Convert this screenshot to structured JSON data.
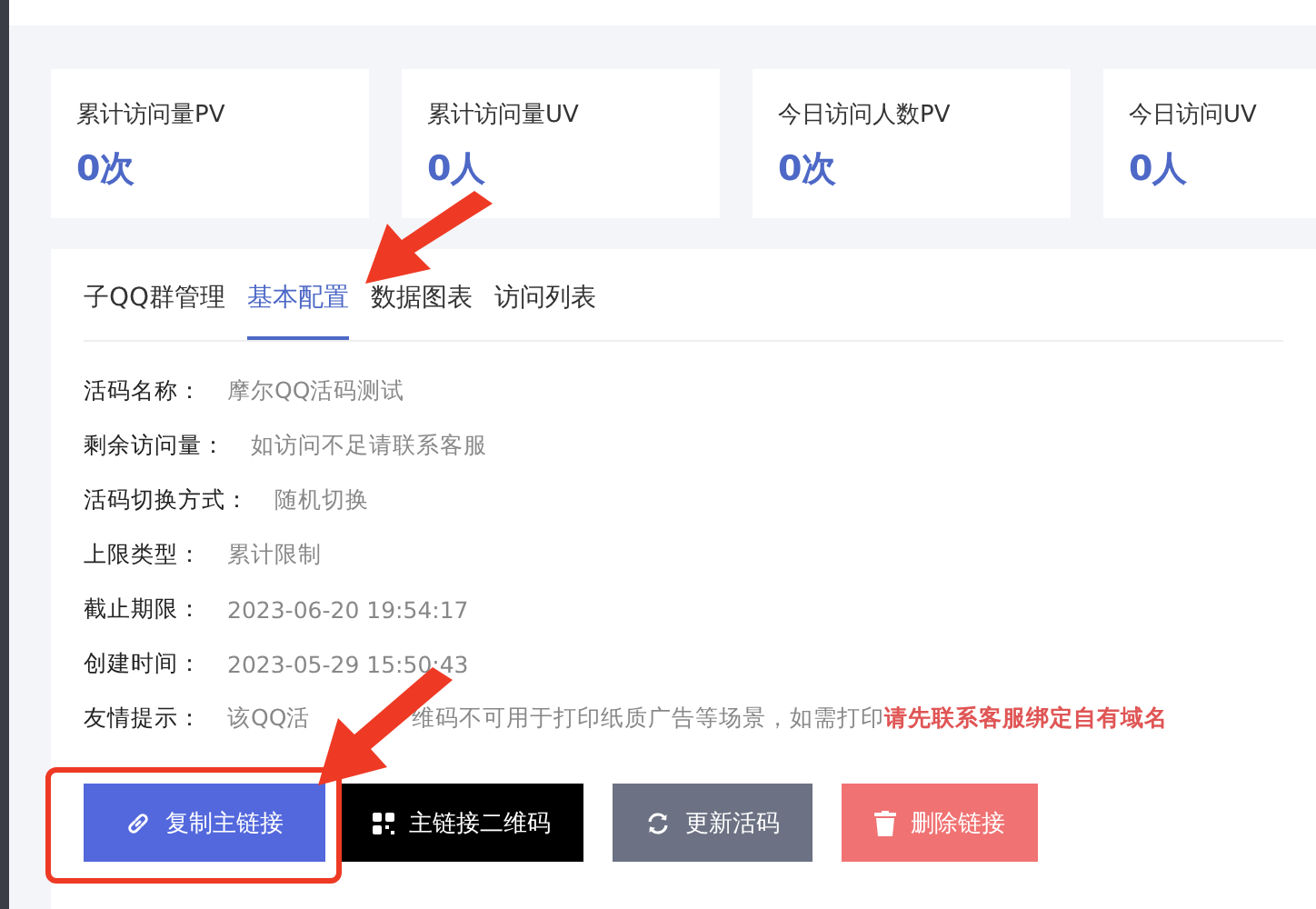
{
  "stats": [
    {
      "label": "累计访问量PV",
      "value": "0次"
    },
    {
      "label": "累计访问量UV",
      "value": "0人"
    },
    {
      "label": "今日访问人数PV",
      "value": "0次"
    },
    {
      "label": "今日访问UV",
      "value": "0人"
    }
  ],
  "tabs": [
    {
      "label": "子QQ群管理",
      "selected": false
    },
    {
      "label": "基本配置",
      "selected": true
    },
    {
      "label": "数据图表",
      "selected": false
    },
    {
      "label": "访问列表",
      "selected": false
    }
  ],
  "fields": [
    {
      "label": "活码名称：",
      "value": "摩尔QQ活码测试"
    },
    {
      "label": "剩余访问量：",
      "value": "如访问不足请联系客服"
    },
    {
      "label": "活码切换方式：",
      "value": "随机切换"
    },
    {
      "label": "上限类型：",
      "value": "累计限制"
    },
    {
      "label": "截止期限：",
      "value": "2023-06-20 19:54:17"
    },
    {
      "label": "创建时间：",
      "value": "2023-05-29 15:50:43"
    }
  ],
  "notice": {
    "label": "友情提示：",
    "text_before_arrow": "该QQ活",
    "text_after_arrow": "维码不可用于打印纸质广告等场景，如需打印",
    "highlight": "请先联系客服绑定自有域名"
  },
  "buttons": [
    {
      "label": "复制主链接",
      "kind": "link"
    },
    {
      "label": "主链接二维码",
      "kind": "qr"
    },
    {
      "label": "更新活码",
      "kind": "refresh"
    },
    {
      "label": "删除链接",
      "kind": "delete"
    }
  ]
}
